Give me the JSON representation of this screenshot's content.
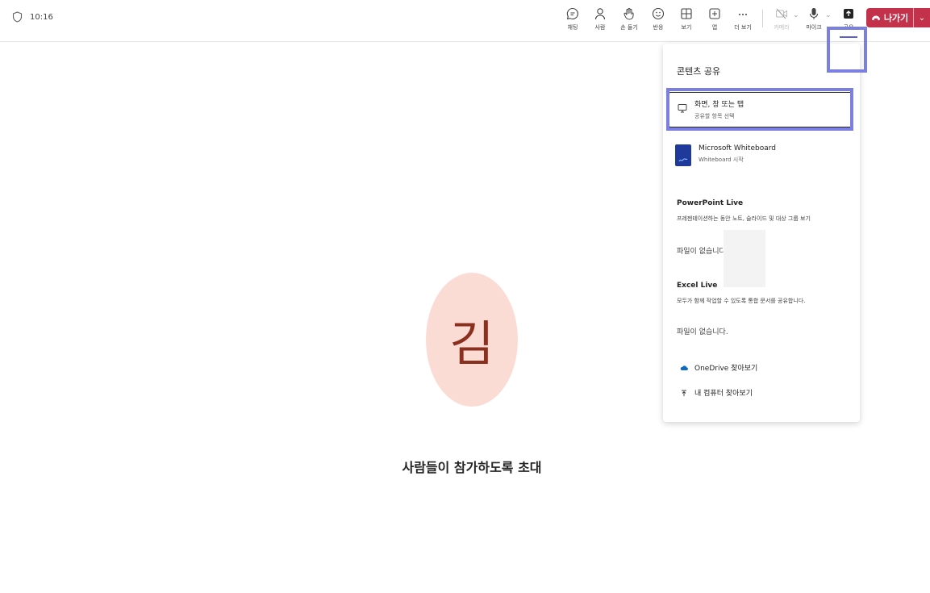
{
  "meeting": {
    "timer": "10:16"
  },
  "toolbar": {
    "chat": "채팅",
    "people": "사람",
    "raise_hand": "손 들기",
    "react": "반응",
    "view": "보기",
    "apps": "앱",
    "more": "더 보기",
    "camera": "카메라",
    "mic": "마이크",
    "share": "공유",
    "leave": "나가기"
  },
  "stage": {
    "avatar_initial": "김",
    "invite_text": "사람들이 참가하도록 초대"
  },
  "share_panel": {
    "title": "콘텐츠 공유",
    "screen_option": {
      "title": "화면, 창 또는 탭",
      "subtitle": "공유할 항목 선택"
    },
    "whiteboard_option": {
      "title": "Microsoft Whiteboard",
      "subtitle": "Whiteboard 시작"
    },
    "powerpoint": {
      "title": "PowerPoint Live",
      "desc": "프레젠테이션하는 동안 노트, 슬라이드 및 대상 그룹 보기",
      "empty": "파일이 없습니다"
    },
    "excel": {
      "title": "Excel Live",
      "desc": "모두가 함께 작업할 수 있도록 통합 문서를 공유합니다.",
      "empty": "파일이 없습니다."
    },
    "onedrive": "OneDrive 찾아보기",
    "computer": "내 컴퓨터 찾아보기"
  },
  "colors": {
    "accent": "#5b5fc7",
    "leave": "#c4314b",
    "avatar_bg": "#fbdcd4",
    "highlight": "#7b7fe0"
  }
}
